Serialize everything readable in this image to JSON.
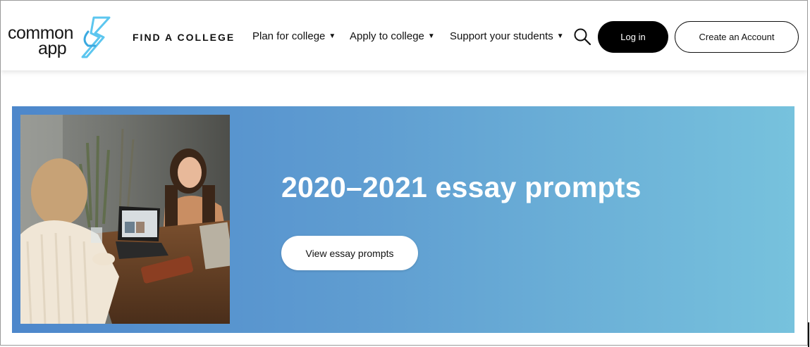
{
  "logo": {
    "line1": "common",
    "line2": "app",
    "mark_color": "#4fc3ee"
  },
  "nav": {
    "find_college": "FIND A COLLEGE",
    "menus": [
      {
        "label": "Plan for college",
        "caret": "▼"
      },
      {
        "label": "Apply to college",
        "caret": "▼"
      },
      {
        "label": "Support your students",
        "caret": "▼"
      }
    ],
    "search_icon": "search-icon",
    "login_label": "Log in",
    "create_account_label": "Create an Account"
  },
  "hero": {
    "title": "2020–2021 essay prompts",
    "button_label": "View essay prompts",
    "photo": "two-students-at-laptop-photo",
    "gradient": [
      "#4d87cb",
      "#77c2dd"
    ]
  }
}
